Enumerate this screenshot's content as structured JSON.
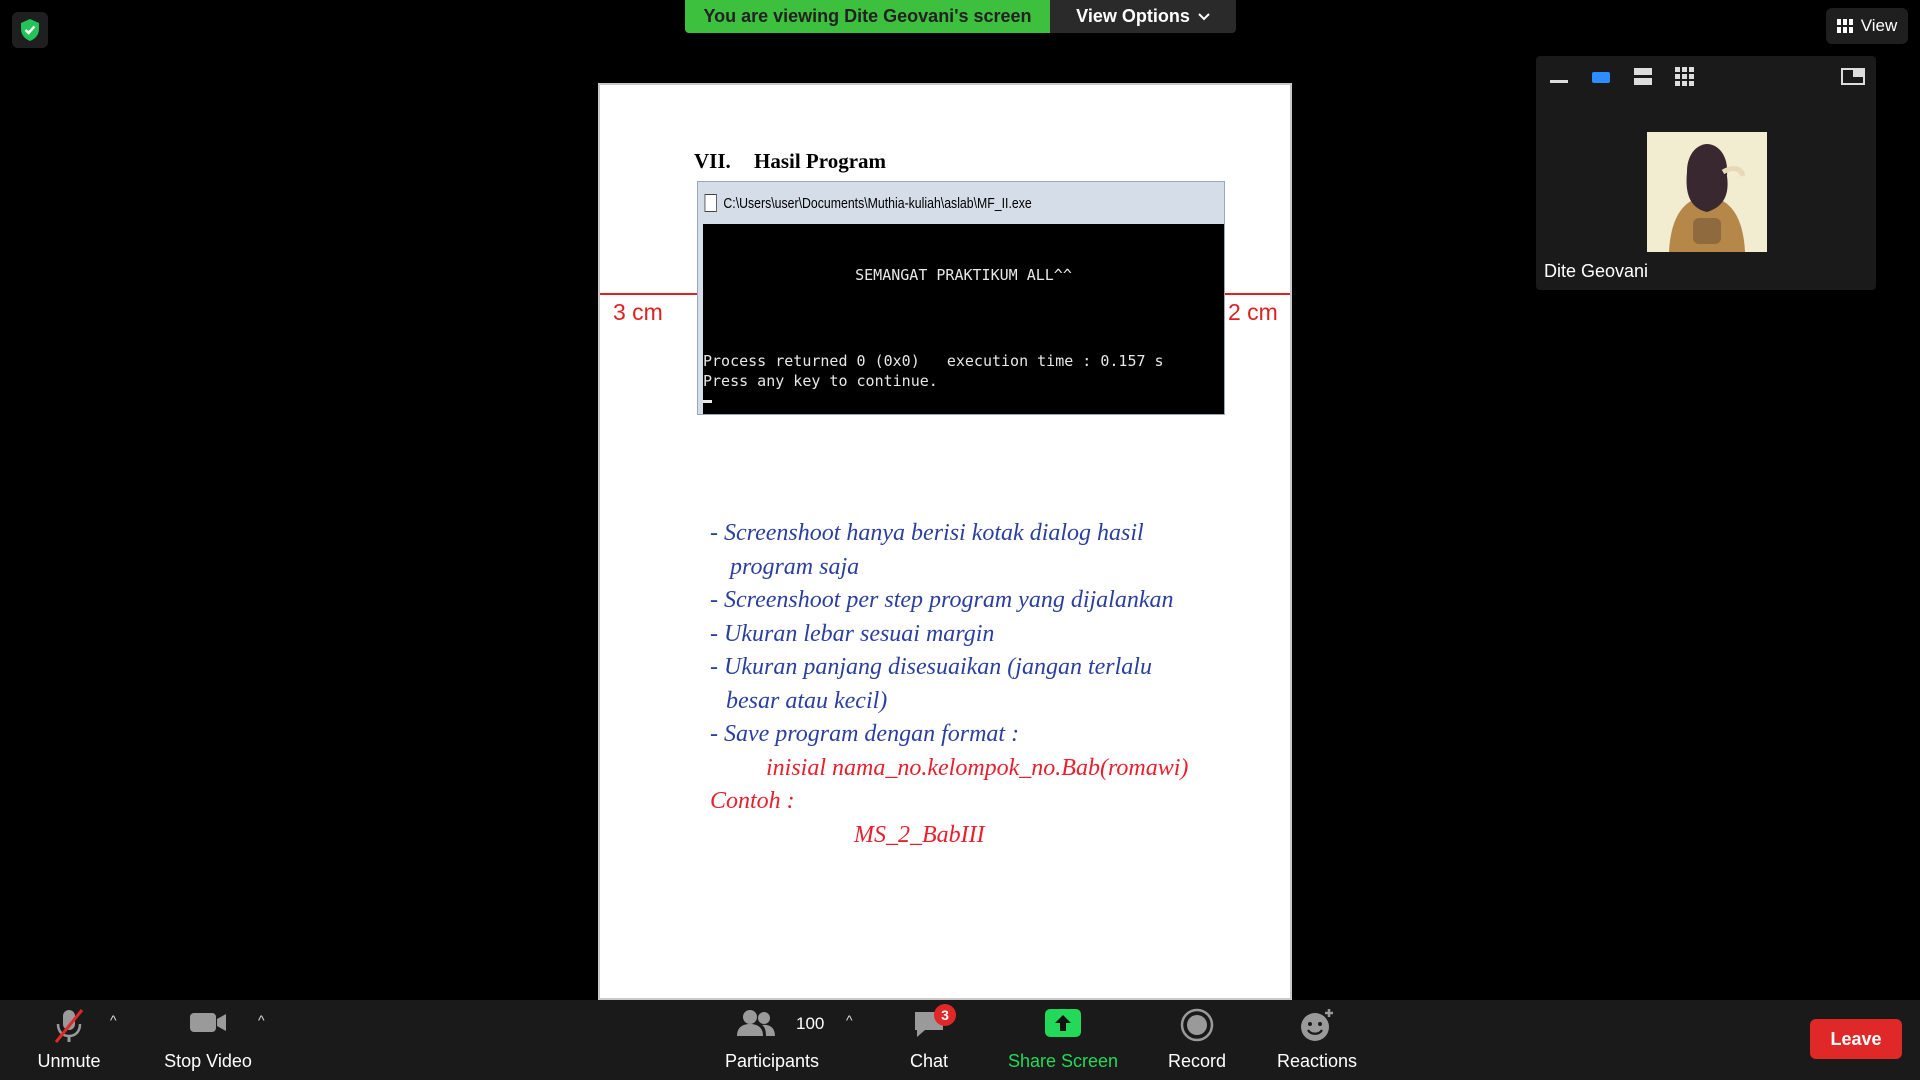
{
  "banner": {
    "viewing_text": "You are viewing Dite Geovani's screen",
    "view_options_label": "View Options"
  },
  "view_button": {
    "label": "View"
  },
  "document": {
    "heading_number": "VII.",
    "heading_text": "Hasil Program",
    "console": {
      "title": "C:\\Users\\user\\Documents\\Muthia-kuliah\\aslab\\MF_II.exe",
      "line1": "SEMANGAT PRAKTIKUM ALL^^",
      "line2": "Process returned 0 (0x0)   execution time : 0.157 s",
      "line3": "Press any key to continue."
    },
    "margin_left": "3 cm",
    "margin_right": "2 cm",
    "notes": [
      "- Screenshoot hanya berisi kotak dialog hasil",
      "program saja",
      "-  Screenshoot per step program yang dijalankan",
      "- Ukuran lebar sesuai margin",
      "- Ukuran panjang disesuaikan (jangan terlalu",
      "besar atau kecil)",
      "- Save program dengan format :",
      "inisial nama_no.kelompok_no.Bab(romawi)",
      "Contoh :",
      "MS_2_BabIII"
    ]
  },
  "self_view": {
    "name": "Dite Geovani"
  },
  "toolbar": {
    "unmute": "Unmute",
    "stop_video": "Stop Video",
    "participants_count": "100",
    "participants": "Participants",
    "chat": "Chat",
    "chat_badge": "3",
    "share_screen": "Share Screen",
    "record": "Record",
    "reactions": "Reactions",
    "leave": "Leave"
  },
  "colors": {
    "banner_green": "#3dc03d",
    "leave_red": "#e02828",
    "note_blue": "#2b3fa0",
    "note_red": "#e8202e",
    "share_green": "#23d959"
  }
}
